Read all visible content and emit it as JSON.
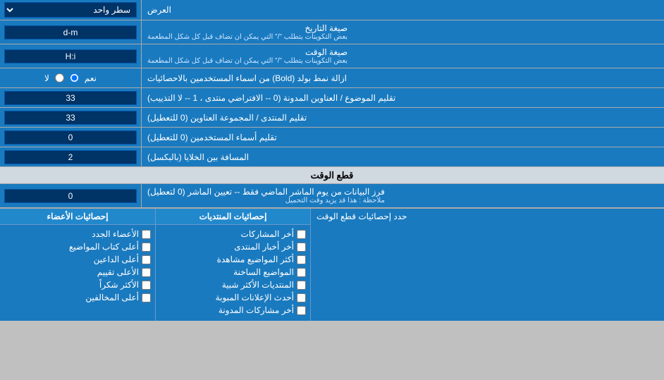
{
  "page": {
    "title": "العرض",
    "rows": [
      {
        "id": "line-display",
        "label": "العرض",
        "input_type": "select",
        "value": "سطر واحد"
      },
      {
        "id": "date-format",
        "label": "صيغة التاريخ\nبعض التكوينات يتطلب \"/\" التي يمكن ان تضاف قبل كل شكل المطعمة",
        "label_line1": "صيغة التاريخ",
        "label_line2": "بعض التكوينات يتطلب \"/\" التي يمكن ان تضاف قبل كل شكل المطعمة",
        "input_type": "text",
        "value": "d-m"
      },
      {
        "id": "time-format",
        "label_line1": "صيغة الوقت",
        "label_line2": "بعض التكوينات يتطلب \"/\" التي يمكن ان تضاف قبل كل شكل المطعمة",
        "input_type": "text",
        "value": "H:i"
      },
      {
        "id": "bold-remove",
        "label": "ازالة نمط بولد (Bold) من اسماء المستخدمين بالاحصائيات",
        "input_type": "radio",
        "option1": "نعم",
        "option2": "لا",
        "selected": "نعم"
      },
      {
        "id": "subject-trim",
        "label": "تقليم الموضوع / العناوين المدونة (0 -- الافتراضي منتدى ، 1 -- لا التذييب)",
        "input_type": "text",
        "value": "33"
      },
      {
        "id": "forum-trim",
        "label": "تقليم المنتدى / المجموعة العناوين (0 للتعطيل)",
        "input_type": "text",
        "value": "33"
      },
      {
        "id": "username-trim",
        "label": "تقليم أسماء المستخدمين (0 للتعطيل)",
        "input_type": "text",
        "value": "0"
      },
      {
        "id": "cell-spacing",
        "label": "المسافة بين الخلايا (بالبكسل)",
        "input_type": "text",
        "value": "2"
      }
    ],
    "cutoff_section": {
      "title": "قطع الوقت",
      "rows": [
        {
          "id": "days-filter",
          "label_line1": "فرز البيانات من يوم الماشر الماضي فقط -- تعيين الماشر (0 لتعطيل)",
          "label_line2": "ملاحظة : هذا قد يزيد وقت التحميل",
          "input_type": "text",
          "value": "0"
        }
      ]
    },
    "stats_section": {
      "label": "حدد إحصائيات قطع الوقت",
      "col1_header": "إحصائيات المنتديات",
      "col2_header": "إحصائيات الأعضاء",
      "col1_items": [
        {
          "label": "أخر المشاركات",
          "checked": false
        },
        {
          "label": "أخر أخبار المنتدى",
          "checked": false
        },
        {
          "label": "أكثر المواضيع مشاهدة",
          "checked": false
        },
        {
          "label": "المواضيع الساخنة",
          "checked": false
        },
        {
          "label": "المنتديات الأكثر شبية",
          "checked": false
        },
        {
          "label": "أحدث الإعلانات المبوبة",
          "checked": false
        },
        {
          "label": "أخر مشاركات المدونة",
          "checked": false
        }
      ],
      "col2_items": [
        {
          "label": "الأعضاء الجدد",
          "checked": false
        },
        {
          "label": "أعلى كتاب المواضيع",
          "checked": false
        },
        {
          "label": "أعلى الداعين",
          "checked": false
        },
        {
          "label": "الأعلى تقييم",
          "checked": false
        },
        {
          "label": "الأكثر شكراً",
          "checked": false
        },
        {
          "label": "أعلى المخالفين",
          "checked": false
        }
      ]
    }
  }
}
